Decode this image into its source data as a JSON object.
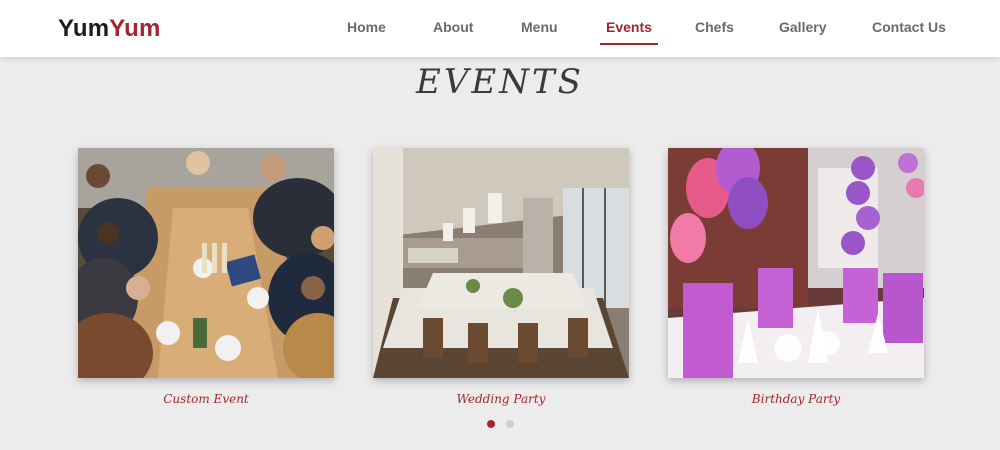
{
  "brand": {
    "part1": "Yum",
    "part2": "Yum"
  },
  "nav": {
    "items": [
      {
        "label": "Home"
      },
      {
        "label": "About"
      },
      {
        "label": "Menu"
      },
      {
        "label": "Events",
        "active": true
      },
      {
        "label": "Chefs"
      },
      {
        "label": "Gallery"
      },
      {
        "label": "Contact Us"
      }
    ]
  },
  "section": {
    "title": "EVENTS"
  },
  "events": [
    {
      "caption": "Custom Event",
      "image": "people-toasting-at-table-photo"
    },
    {
      "caption": "Wedding Party",
      "image": "restaurant-banquet-hall-photo"
    },
    {
      "caption": "Birthday Party",
      "image": "purple-balloon-party-tables-photo"
    }
  ],
  "carousel": {
    "pages": 2,
    "active_page": 1
  },
  "colors": {
    "accent": "#a3262e",
    "background": "#ececec",
    "nav_text": "#6a6a6a"
  }
}
